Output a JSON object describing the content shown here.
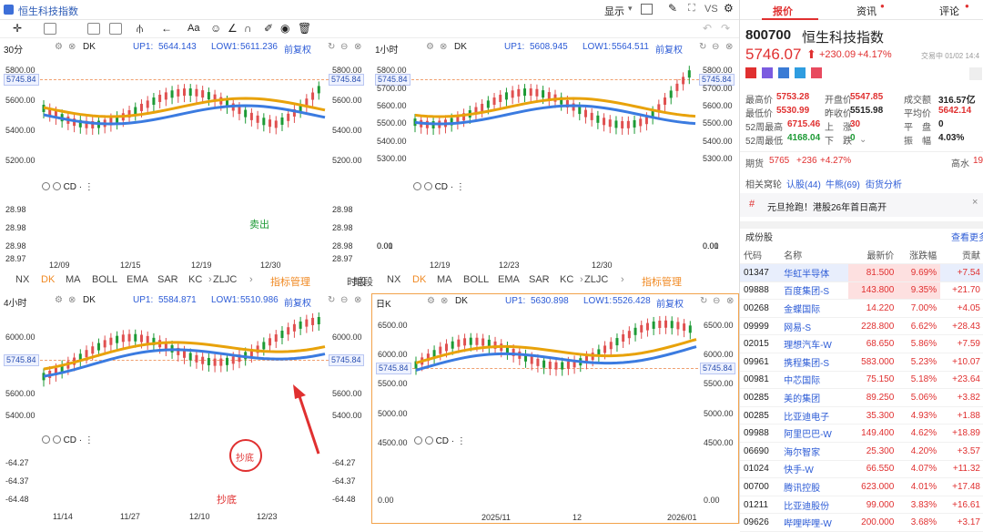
{
  "app": {
    "title": "恒生科技指数",
    "display_label": "显示",
    "vs_label": "VS"
  },
  "panes": [
    {
      "period": "30分",
      "ind": "DK",
      "up": "UP1:",
      "up_v": "5644.143",
      "low": "LOW1:",
      "low_v": "5611.236",
      "fq": "前复权",
      "y_ticks": [
        "5800.00",
        "5745.84",
        "5600.00",
        "5400.00",
        "5200.00"
      ],
      "hi": "5753.28",
      "lo": "5348.31",
      "sub_ticks": [
        "28.98",
        "28.98",
        "28.98",
        "28.97"
      ],
      "sig": "卖出",
      "dates": [
        "12/09",
        "12/15",
        "12/19",
        "12/30"
      ]
    },
    {
      "period": "1小时",
      "ind": "DK",
      "up": "UP1:",
      "up_v": "5608.945",
      "low": "LOW1:",
      "low_v": "5564.511",
      "fq": "前复权",
      "y_ticks": [
        "5800.00",
        "5745.84",
        "5700.00",
        "5600.00",
        "5500.00",
        "5400.00",
        "5300.00"
      ],
      "hi": "5753.28",
      "lo": "5381.37",
      "sub_ticks": [
        "0.01",
        "0.00"
      ],
      "dates": [
        "12/19",
        "12/23",
        "12/30"
      ]
    },
    {
      "period": "4小时",
      "ind": "DK",
      "up": "UP1:",
      "up_v": "5584.871",
      "low": "LOW1:",
      "low_v": "5510.986",
      "fq": "前复权",
      "y_ticks": [
        "6000.00",
        "5800.00",
        "5745.84",
        "5600.00",
        "5400.00"
      ],
      "hi": "6025.53",
      "lo": "5348.31",
      "sub_ticks": [
        "-64.27",
        "-64.37",
        "-64.48"
      ],
      "circle_label": "抄底",
      "sig": "抄底",
      "dates": [
        "11/14",
        "11/27",
        "12/10",
        "12/23"
      ]
    },
    {
      "period": "日K",
      "ind": "DK",
      "up": "UP1:",
      "up_v": "5630.898",
      "low": "LOW1:",
      "low_v": "5526.428",
      "fq": "前复权",
      "y_ticks": [
        "6500.00",
        "6000.00",
        "5745.84",
        "5500.00",
        "5000.00",
        "4500.00"
      ],
      "hi": "6380.88",
      "lo": "5348.31",
      "sub_ticks": [
        "0.00"
      ],
      "dates": [
        "2025/11",
        "12",
        "2026/01"
      ]
    }
  ],
  "cd_label": "CD",
  "indicators": {
    "items": [
      "NX",
      "DK",
      "MA",
      "BOLL",
      "EMA",
      "SAR",
      "KC",
      "ZLJC"
    ],
    "manage": "指标管理",
    "period": "时段"
  },
  "right": {
    "tabs": [
      "报价",
      "资讯",
      "评论"
    ],
    "code": "800700",
    "name": "恒生科技指数",
    "price": "5746.07",
    "change": "+230.09",
    "pct": "+4.17%",
    "status": "交易中 01/02 14:4",
    "stats": [
      {
        "k": "最高价",
        "v": "5753.28",
        "c": "red"
      },
      {
        "k": "开盘价",
        "v": "5547.85",
        "c": "red"
      },
      {
        "k": "成交额",
        "v": "316.57亿",
        "c": ""
      },
      {
        "k": "最低价",
        "v": "5530.99",
        "c": "red"
      },
      {
        "k": "昨收价",
        "v": "5515.98",
        "c": ""
      },
      {
        "k": "平均价",
        "v": "5642.14",
        "c": "red"
      },
      {
        "k": "52周最高",
        "v": "6715.46",
        "c": "red"
      },
      {
        "k": "上　涨",
        "v": "30",
        "c": "red"
      },
      {
        "k": "平　盘",
        "v": "0",
        "c": ""
      },
      {
        "k": "52周最低",
        "v": "4168.04",
        "c": "grn"
      },
      {
        "k": "下　跌",
        "v": "0",
        "c": "grn"
      },
      {
        "k": "振　幅",
        "v": "4.03%",
        "c": ""
      }
    ],
    "futures_label": "期货",
    "futures": "5765",
    "fchg": "+236",
    "fpct": "+4.27%",
    "gaoshui": "高水",
    "gaoshui_v": "19",
    "related_label": "相关窝轮",
    "rel1": "认股(44)",
    "rel2": "牛熊(69)",
    "rel3": "街货分析",
    "news": "元旦抢跑！港股26年首日高开",
    "const_title": "成份股",
    "more": "查看更多",
    "headers": [
      "代码",
      "名称",
      "最新价",
      "涨跌幅",
      "贡献"
    ],
    "rows": [
      [
        "01347",
        "华虹半导体",
        "81.500",
        "9.69%",
        "+7.54"
      ],
      [
        "09888",
        "百度集团-S",
        "143.800",
        "9.35%",
        "+21.70"
      ],
      [
        "00268",
        "金蝶国际",
        "14.220",
        "7.00%",
        "+4.05"
      ],
      [
        "09999",
        "网易-S",
        "228.800",
        "6.62%",
        "+28.43"
      ],
      [
        "02015",
        "理想汽车-W",
        "68.650",
        "5.86%",
        "+7.59"
      ],
      [
        "09961",
        "携程集团-S",
        "583.000",
        "5.23%",
        "+10.07"
      ],
      [
        "00981",
        "中芯国际",
        "75.150",
        "5.18%",
        "+23.64"
      ],
      [
        "00285",
        "美的集团",
        "89.250",
        "5.06%",
        "+3.82"
      ],
      [
        "00285",
        "比亚迪电子",
        "35.300",
        "4.93%",
        "+1.88"
      ],
      [
        "09988",
        "阿里巴巴-W",
        "149.400",
        "4.62%",
        "+18.89"
      ],
      [
        "06690",
        "海尔智家",
        "25.300",
        "4.20%",
        "+3.57"
      ],
      [
        "01024",
        "快手-W",
        "66.550",
        "4.07%",
        "+11.32"
      ],
      [
        "00700",
        "腾讯控股",
        "623.000",
        "4.01%",
        "+17.48"
      ],
      [
        "01211",
        "比亚迪股份",
        "99.000",
        "3.83%",
        "+16.61"
      ],
      [
        "09626",
        "哔哩哔哩-W",
        "200.000",
        "3.68%",
        "+3.17"
      ]
    ]
  }
}
